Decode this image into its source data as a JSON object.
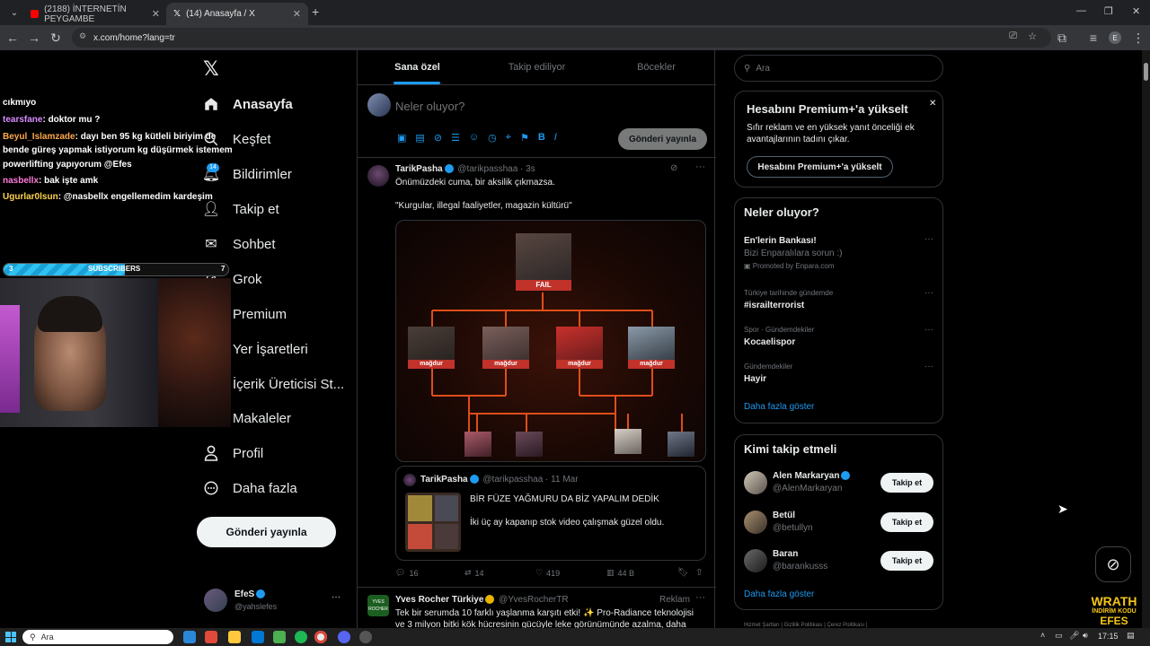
{
  "browser": {
    "tabs": [
      {
        "title": "(2188) İNTERNETİN PEYGAMBE"
      },
      {
        "title": "(14) Anasayfa / X"
      }
    ],
    "new_tab": "+",
    "url": "x.com/home?lang=tr"
  },
  "nav": {
    "logo": "𝕏",
    "items": [
      {
        "label": "Anasayfa",
        "icon": "home-icon"
      },
      {
        "label": "Keşfet",
        "icon": "search-icon"
      },
      {
        "label": "Bildirimler",
        "icon": "bell-icon",
        "badge": "14"
      },
      {
        "label": "Takip et",
        "icon": "person-icon"
      },
      {
        "label": "Sohbet",
        "icon": "mail-icon"
      },
      {
        "label": "Grok",
        "icon": "grok-icon"
      },
      {
        "label": "Premium",
        "icon": "x-icon"
      },
      {
        "label": "Yer İşaretleri",
        "icon": "bookmark-icon"
      },
      {
        "label": "İçerik Üreticisi St...",
        "icon": "creator-icon"
      },
      {
        "label": "Makaleler",
        "icon": "article-icon"
      },
      {
        "label": "Profil",
        "icon": "profile-icon"
      },
      {
        "label": "Daha fazla",
        "icon": "more-icon"
      }
    ],
    "post_button": "Gönderi yayınla",
    "account": {
      "name": "EfeS",
      "handle": "@yahslefes",
      "more": "···"
    }
  },
  "feed": {
    "tabs": [
      "Sana özel",
      "Takip ediliyor",
      "Böcekler"
    ],
    "composer": {
      "placeholder": "Neler oluyor?",
      "post_button": "Gönderi yayınla"
    },
    "tweet": {
      "name": "TarikPasha",
      "handle": "@tarikpasshaa",
      "time": "· 3s",
      "line1": "Önümüzdeki cuma, bir aksilik çıkmazsa.",
      "line2": "\"Kurgular, illegal faaliyetler, magazin kültürü\"",
      "image_labels": {
        "top": "FAIL",
        "victim": "mağdur"
      },
      "quote": {
        "name": "TarikPasha",
        "handle": "@tarikpasshaa",
        "time": "· 11 Mar",
        "title": "BİR FÜZE YAĞMURU DA BİZ YAPALIM DEDİK",
        "body": "İki üç ay kapanıp stok video çalışmak güzel oldu."
      },
      "stats": {
        "replies": "16",
        "reposts": "14",
        "likes": "419",
        "views": "44 B"
      }
    },
    "ad_tweet": {
      "name": "Yves Rocher Türkiye",
      "handle": "@YvesRocherTR",
      "tag": "Reklam",
      "line1": "Tek bir serumda 10 farklı yaşlanma karşıtı etki! ✨ Pro-Radiance teknolojisi",
      "line2": "ve 3 milyon bitki kök hücresinin gücüyle leke görünümünde azalma, daha"
    }
  },
  "right": {
    "search_placeholder": "Ara",
    "premium": {
      "title": "Hesabını Premium+'a yükselt",
      "body": "Sıfır reklam ve en yüksek yanıt önceliği ek avantajlarının tadını çıkar.",
      "button": "Hesabını Premium+'a yükselt"
    },
    "trends": {
      "title": "Neler oluyor?",
      "items": [
        {
          "context": "",
          "title": "En'lerin Bankası!",
          "sub": "Bizi Enparalılara sorun :)",
          "promo": "Promoted by Enpara.com"
        },
        {
          "context": "Türkiye tarihinde gündemde",
          "title": "#israilterrorist"
        },
        {
          "context": "Spor · Gündemdekiler",
          "title": "Kocaelispor"
        },
        {
          "context": "Gündemdekiler",
          "title": "Hayir"
        }
      ],
      "more": "Daha fazla göster"
    },
    "who_to_follow": {
      "title": "Kimi takip etmeli",
      "users": [
        {
          "name": "Alen Markaryan",
          "handle": "@AlenMarkaryan",
          "button": "Takip et"
        },
        {
          "name": "Betül",
          "handle": "@betullyn",
          "button": "Takip et"
        },
        {
          "name": "Baran",
          "handle": "@barankusss",
          "button": "Takip et"
        }
      ],
      "more": "Daha fazla göster"
    },
    "footer": "Hizmet Şartları  |  Gizlilik Politikası  |  Çerez Politikası  |"
  },
  "stream": {
    "chat": [
      {
        "user": "",
        "text": "cıkmıyo"
      },
      {
        "user": "tearsfane",
        "text": ": doktor mu ?"
      },
      {
        "user": "Beyul_Islamzade",
        "text": ": dayı ben 95 kg kütleli biriyim de"
      },
      {
        "user": "",
        "text": "bende güreş yapmak istiyorum kg düşürmek istemem"
      },
      {
        "user": "",
        "text": "powerlifting yapıyorum @Efes"
      },
      {
        "user": "nasbellx",
        "text": ": bak işte amk"
      },
      {
        "user": "Ugurlar0lsun",
        "text": ": @nasbellx engellemedim kardeşim"
      }
    ],
    "sub_bar": {
      "left": "3",
      "label": "SUBSCRIBERS",
      "right": "7"
    },
    "brand_line1": "WRATH",
    "brand_line2": "İNDİRİM KODU",
    "brand_line3": "EFES"
  },
  "taskbar": {
    "search": "Ara",
    "time": "17:15"
  }
}
